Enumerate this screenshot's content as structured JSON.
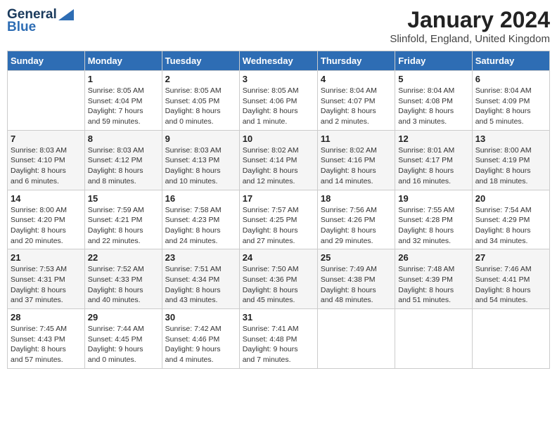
{
  "logo": {
    "general": "General",
    "blue": "Blue"
  },
  "title": "January 2024",
  "location": "Slinfold, England, United Kingdom",
  "days_of_week": [
    "Sunday",
    "Monday",
    "Tuesday",
    "Wednesday",
    "Thursday",
    "Friday",
    "Saturday"
  ],
  "weeks": [
    [
      {
        "day": "",
        "info": ""
      },
      {
        "day": "1",
        "info": "Sunrise: 8:05 AM\nSunset: 4:04 PM\nDaylight: 7 hours\nand 59 minutes."
      },
      {
        "day": "2",
        "info": "Sunrise: 8:05 AM\nSunset: 4:05 PM\nDaylight: 8 hours\nand 0 minutes."
      },
      {
        "day": "3",
        "info": "Sunrise: 8:05 AM\nSunset: 4:06 PM\nDaylight: 8 hours\nand 1 minute."
      },
      {
        "day": "4",
        "info": "Sunrise: 8:04 AM\nSunset: 4:07 PM\nDaylight: 8 hours\nand 2 minutes."
      },
      {
        "day": "5",
        "info": "Sunrise: 8:04 AM\nSunset: 4:08 PM\nDaylight: 8 hours\nand 3 minutes."
      },
      {
        "day": "6",
        "info": "Sunrise: 8:04 AM\nSunset: 4:09 PM\nDaylight: 8 hours\nand 5 minutes."
      }
    ],
    [
      {
        "day": "7",
        "info": "Sunrise: 8:03 AM\nSunset: 4:10 PM\nDaylight: 8 hours\nand 6 minutes."
      },
      {
        "day": "8",
        "info": "Sunrise: 8:03 AM\nSunset: 4:12 PM\nDaylight: 8 hours\nand 8 minutes."
      },
      {
        "day": "9",
        "info": "Sunrise: 8:03 AM\nSunset: 4:13 PM\nDaylight: 8 hours\nand 10 minutes."
      },
      {
        "day": "10",
        "info": "Sunrise: 8:02 AM\nSunset: 4:14 PM\nDaylight: 8 hours\nand 12 minutes."
      },
      {
        "day": "11",
        "info": "Sunrise: 8:02 AM\nSunset: 4:16 PM\nDaylight: 8 hours\nand 14 minutes."
      },
      {
        "day": "12",
        "info": "Sunrise: 8:01 AM\nSunset: 4:17 PM\nDaylight: 8 hours\nand 16 minutes."
      },
      {
        "day": "13",
        "info": "Sunrise: 8:00 AM\nSunset: 4:19 PM\nDaylight: 8 hours\nand 18 minutes."
      }
    ],
    [
      {
        "day": "14",
        "info": "Sunrise: 8:00 AM\nSunset: 4:20 PM\nDaylight: 8 hours\nand 20 minutes."
      },
      {
        "day": "15",
        "info": "Sunrise: 7:59 AM\nSunset: 4:21 PM\nDaylight: 8 hours\nand 22 minutes."
      },
      {
        "day": "16",
        "info": "Sunrise: 7:58 AM\nSunset: 4:23 PM\nDaylight: 8 hours\nand 24 minutes."
      },
      {
        "day": "17",
        "info": "Sunrise: 7:57 AM\nSunset: 4:25 PM\nDaylight: 8 hours\nand 27 minutes."
      },
      {
        "day": "18",
        "info": "Sunrise: 7:56 AM\nSunset: 4:26 PM\nDaylight: 8 hours\nand 29 minutes."
      },
      {
        "day": "19",
        "info": "Sunrise: 7:55 AM\nSunset: 4:28 PM\nDaylight: 8 hours\nand 32 minutes."
      },
      {
        "day": "20",
        "info": "Sunrise: 7:54 AM\nSunset: 4:29 PM\nDaylight: 8 hours\nand 34 minutes."
      }
    ],
    [
      {
        "day": "21",
        "info": "Sunrise: 7:53 AM\nSunset: 4:31 PM\nDaylight: 8 hours\nand 37 minutes."
      },
      {
        "day": "22",
        "info": "Sunrise: 7:52 AM\nSunset: 4:33 PM\nDaylight: 8 hours\nand 40 minutes."
      },
      {
        "day": "23",
        "info": "Sunrise: 7:51 AM\nSunset: 4:34 PM\nDaylight: 8 hours\nand 43 minutes."
      },
      {
        "day": "24",
        "info": "Sunrise: 7:50 AM\nSunset: 4:36 PM\nDaylight: 8 hours\nand 45 minutes."
      },
      {
        "day": "25",
        "info": "Sunrise: 7:49 AM\nSunset: 4:38 PM\nDaylight: 8 hours\nand 48 minutes."
      },
      {
        "day": "26",
        "info": "Sunrise: 7:48 AM\nSunset: 4:39 PM\nDaylight: 8 hours\nand 51 minutes."
      },
      {
        "day": "27",
        "info": "Sunrise: 7:46 AM\nSunset: 4:41 PM\nDaylight: 8 hours\nand 54 minutes."
      }
    ],
    [
      {
        "day": "28",
        "info": "Sunrise: 7:45 AM\nSunset: 4:43 PM\nDaylight: 8 hours\nand 57 minutes."
      },
      {
        "day": "29",
        "info": "Sunrise: 7:44 AM\nSunset: 4:45 PM\nDaylight: 9 hours\nand 0 minutes."
      },
      {
        "day": "30",
        "info": "Sunrise: 7:42 AM\nSunset: 4:46 PM\nDaylight: 9 hours\nand 4 minutes."
      },
      {
        "day": "31",
        "info": "Sunrise: 7:41 AM\nSunset: 4:48 PM\nDaylight: 9 hours\nand 7 minutes."
      },
      {
        "day": "",
        "info": ""
      },
      {
        "day": "",
        "info": ""
      },
      {
        "day": "",
        "info": ""
      }
    ]
  ]
}
